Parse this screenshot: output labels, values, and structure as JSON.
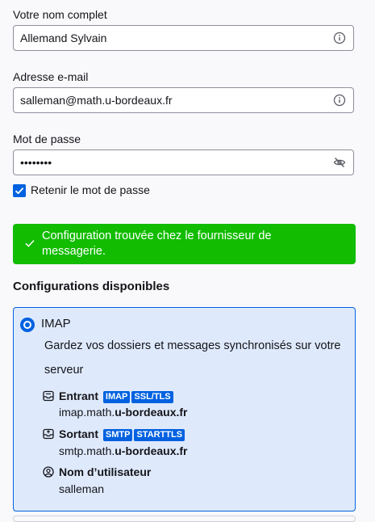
{
  "form": {
    "name_label": "Votre nom complet",
    "name_value": "Allemand Sylvain",
    "email_label": "Adresse e-mail",
    "email_value": "salleman@math.u-bordeaux.fr",
    "password_label": "Mot de passe",
    "password_value": "••••••••",
    "remember_label": "Retenir le mot de passe",
    "remember_checked": true
  },
  "banner": {
    "message": "Configuration trouvée chez le fournisseur de messagerie.",
    "color": "#12bc00"
  },
  "configs": {
    "heading": "Configurations disponibles",
    "option": {
      "protocol": "IMAP",
      "selected": true,
      "description": "Gardez vos dossiers et messages synchronisés sur votre serveur",
      "incoming": {
        "label": "Entrant",
        "badges": [
          "IMAP",
          "SSL/TLS"
        ],
        "host_prefix": "imap.math.",
        "host_domain": "u-bordeaux.fr"
      },
      "outgoing": {
        "label": "Sortant",
        "badges": [
          "SMTP",
          "STARTTLS"
        ],
        "host_prefix": "smtp.math.",
        "host_domain": "u-bordeaux.fr"
      },
      "username": {
        "label": "Nom d’utilisateur",
        "value": "salleman"
      }
    }
  },
  "colors": {
    "accent": "#0061e0",
    "card_bg": "#deeafc",
    "success": "#12bc00"
  },
  "icons": {
    "name_field": "info-icon",
    "email_field": "info-icon",
    "password_field": "eye-slash-icon",
    "banner": "checkmark-icon",
    "incoming": "inbox-icon",
    "outgoing": "outbox-icon",
    "username": "user-icon"
  }
}
